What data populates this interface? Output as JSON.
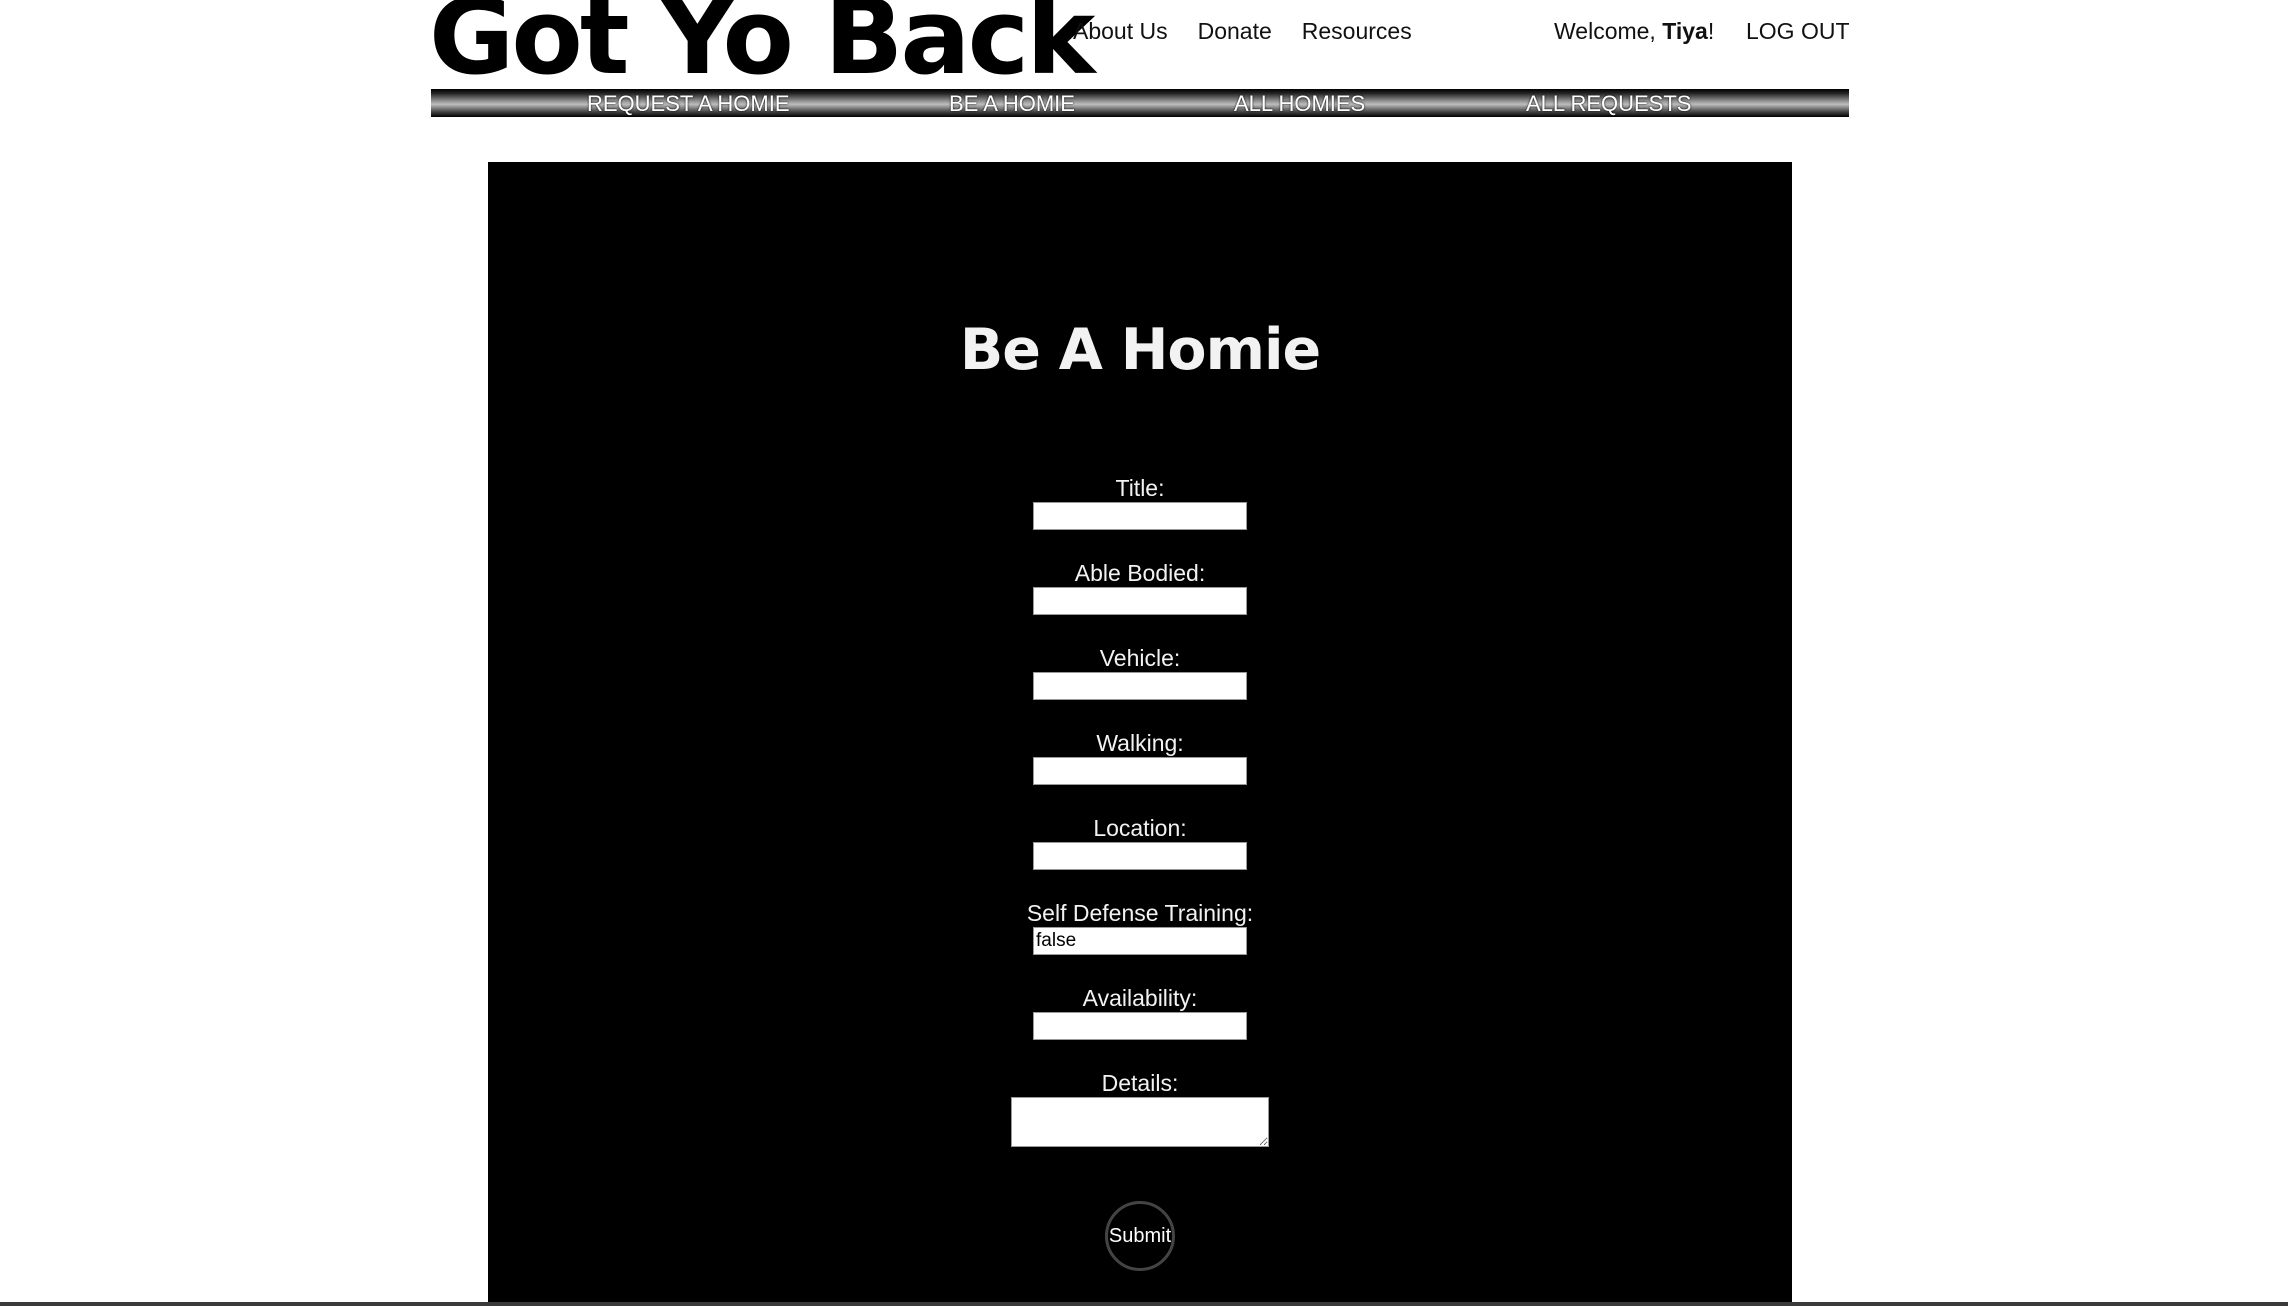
{
  "header": {
    "logo_text": "Got Yo Back",
    "top_links": [
      "About Us",
      "Donate",
      "Resources"
    ],
    "welcome_prefix": "Welcome, ",
    "welcome_name": "Tiya",
    "welcome_suffix": "!",
    "logout_label": "LOG OUT"
  },
  "nav": {
    "items": [
      "REQUEST A HOMIE",
      "BE A HOMIE",
      "ALL HOMIES",
      "ALL REQUESTS"
    ]
  },
  "form": {
    "title": "Be A Homie",
    "fields": [
      {
        "label": "Title:",
        "value": ""
      },
      {
        "label": "Able Bodied:",
        "value": ""
      },
      {
        "label": "Vehicle:",
        "value": ""
      },
      {
        "label": "Walking:",
        "value": ""
      },
      {
        "label": "Location:",
        "value": ""
      },
      {
        "label": "Self Defense Training:",
        "value": "false"
      },
      {
        "label": "Availability:",
        "value": ""
      }
    ],
    "details_label": "Details:",
    "details_value": "",
    "submit_label": "Submit"
  },
  "colors": {
    "panel_bg": "#000000",
    "page_bg": "#ffffff",
    "text_light": "#f2f2f2"
  }
}
